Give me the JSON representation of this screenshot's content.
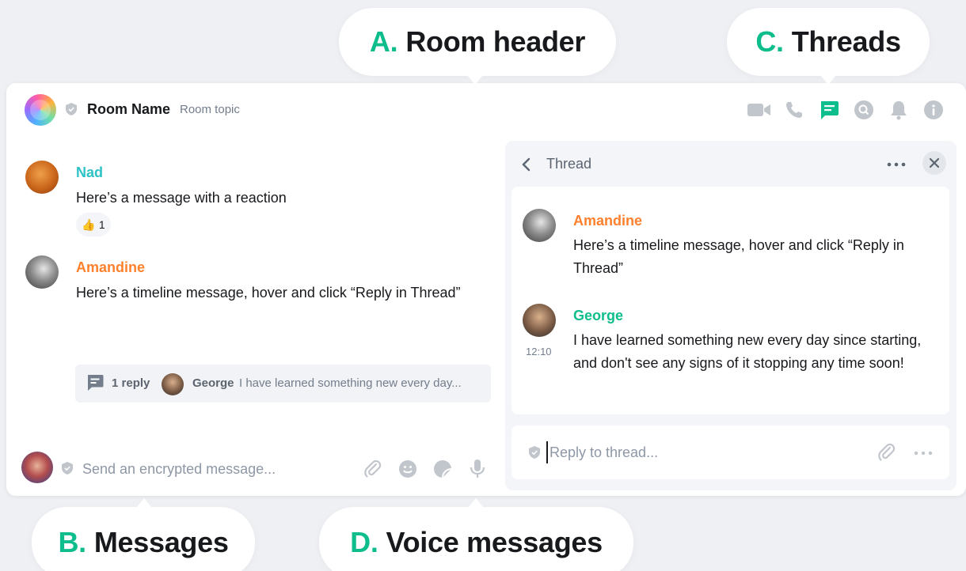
{
  "callouts": {
    "a": {
      "letter": "A.",
      "text": "Room header"
    },
    "b": {
      "letter": "B.",
      "text": "Messages"
    },
    "c": {
      "letter": "C.",
      "text": "Threads"
    },
    "d": {
      "letter": "D.",
      "text": "Voice messages"
    }
  },
  "colors": {
    "accent": "#0dbd8b",
    "icon_gray": "#c1c6cd",
    "nad": "#2dc2c5",
    "amandine": "#ff812d",
    "george": "#0dbd8b"
  },
  "header": {
    "room_name": "Room Name",
    "room_topic": "Room topic",
    "icons": [
      "video-call-icon",
      "voice-call-icon",
      "threads-icon",
      "search-icon",
      "notifications-icon",
      "room-info-icon"
    ],
    "active_icon": "threads-icon"
  },
  "timeline": {
    "messages": [
      {
        "sender": "Nad",
        "body": "Here’s a message with a reaction",
        "reaction": {
          "emoji": "👍",
          "count": "1"
        }
      },
      {
        "sender": "Amandine",
        "body": "Here’s a timeline message, hover and click “Reply in Thread”",
        "thread_summary": {
          "count": "1 reply",
          "last_sender": "George",
          "preview": "I have learned something new every day..."
        }
      }
    ]
  },
  "composer": {
    "placeholder": "Send an encrypted message...",
    "icons": [
      "attachment-icon",
      "emoji-icon",
      "sticker-icon",
      "microphone-icon"
    ]
  },
  "thread": {
    "title": "Thread",
    "messages": [
      {
        "sender": "Amandine",
        "body": "Here’s a timeline message, hover and click “Reply in Thread”"
      },
      {
        "sender": "George",
        "time": "12:10",
        "body": "I have learned something new every day since starting, and don't see any signs of it stopping any time soon!"
      }
    ],
    "composer_placeholder": "Reply to thread..."
  }
}
